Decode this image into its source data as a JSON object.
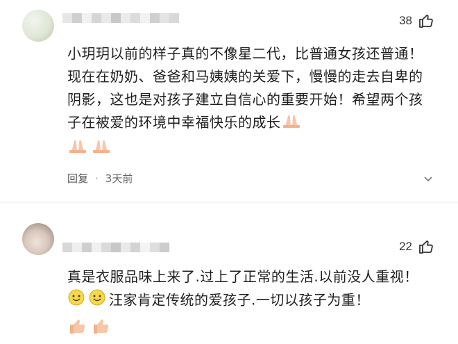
{
  "comments": [
    {
      "likes": "38",
      "text": "小玥玥以前的样子真的不像星二代，比普通女孩还普通！现在在奶奶、爸爸和马姨姨的关爱下，慢慢的走去自卑的阴影，这也是对孩子建立自信心的重要开始！希望两个孩子在被爱的环境中幸福快乐的成长",
      "reply_label": "回复",
      "time": "3天前"
    },
    {
      "likes": "22",
      "text_1": "真是衣服品味上来了.过上了正常的生活.以前没人重视！",
      "text_2": "汪家肯定传统的爱孩子.一切以孩子为重！"
    }
  ],
  "colors": {
    "accent": "#f2b28a"
  },
  "icons": {
    "like": "thumbs-up-icon",
    "praying": "praying-hands-emoji",
    "smile": "smiling-face-emoji",
    "thumb_emoji": "thumbs-up-emoji",
    "expand": "chevron-down-icon"
  }
}
